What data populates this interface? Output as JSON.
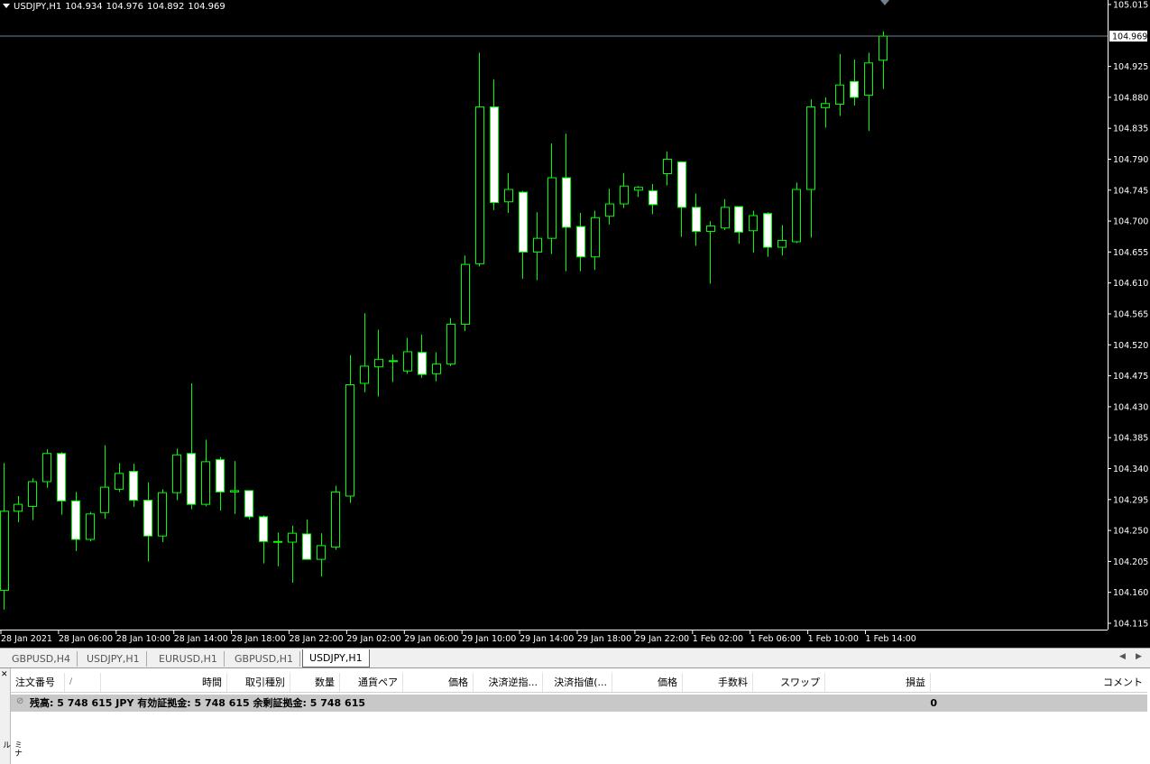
{
  "chart": {
    "symbol": "USDJPY,H1",
    "ohlc": {
      "open": "104.934",
      "high": "104.976",
      "low": "104.892",
      "close": "104.969"
    },
    "current_price": "104.969",
    "price_scale": [
      "105.015",
      "104.925",
      "104.880",
      "104.835",
      "104.790",
      "104.745",
      "104.700",
      "104.655",
      "104.610",
      "104.565",
      "104.520",
      "104.475",
      "104.430",
      "104.385",
      "104.340",
      "104.295",
      "104.250",
      "104.205",
      "104.160",
      "104.115"
    ],
    "time_labels": [
      "28 Jan 2021",
      "28 Jan 06:00",
      "28 Jan 10:00",
      "28 Jan 14:00",
      "28 Jan 18:00",
      "28 Jan 22:00",
      "29 Jan 02:00",
      "29 Jan 06:00",
      "29 Jan 10:00",
      "29 Jan 14:00",
      "29 Jan 18:00",
      "29 Jan 22:00",
      "1 Feb 02:00",
      "1 Feb 06:00",
      "1 Feb 10:00",
      "1 Feb 14:00"
    ],
    "colors": {
      "background": "#000000",
      "bull_wick": "#00ff00",
      "bear_body": "#ffffff",
      "price_line": "#708090",
      "axis": "#ffffff"
    },
    "candles": [
      {
        "o": 104.163,
        "h": 104.348,
        "l": 104.135,
        "c": 104.278
      },
      {
        "o": 104.278,
        "h": 104.3,
        "l": 104.262,
        "c": 104.288
      },
      {
        "o": 104.285,
        "h": 104.326,
        "l": 104.265,
        "c": 104.321
      },
      {
        "o": 104.321,
        "h": 104.368,
        "l": 104.312,
        "c": 104.362
      },
      {
        "o": 104.362,
        "h": 104.364,
        "l": 104.273,
        "c": 104.293
      },
      {
        "o": 104.293,
        "h": 104.306,
        "l": 104.22,
        "c": 104.237
      },
      {
        "o": 104.237,
        "h": 104.277,
        "l": 104.234,
        "c": 104.274
      },
      {
        "o": 104.276,
        "h": 104.374,
        "l": 104.267,
        "c": 104.313
      },
      {
        "o": 104.31,
        "h": 104.348,
        "l": 104.306,
        "c": 104.333
      },
      {
        "o": 104.336,
        "h": 104.347,
        "l": 104.284,
        "c": 104.294
      },
      {
        "o": 104.294,
        "h": 104.32,
        "l": 104.205,
        "c": 104.242
      },
      {
        "o": 104.242,
        "h": 104.31,
        "l": 104.233,
        "c": 104.305
      },
      {
        "o": 104.305,
        "h": 104.369,
        "l": 104.294,
        "c": 104.36
      },
      {
        "o": 104.362,
        "h": 104.464,
        "l": 104.281,
        "c": 104.288
      },
      {
        "o": 104.288,
        "h": 104.382,
        "l": 104.285,
        "c": 104.35
      },
      {
        "o": 104.353,
        "h": 104.357,
        "l": 104.279,
        "c": 104.306
      },
      {
        "o": 104.306,
        "h": 104.351,
        "l": 104.274,
        "c": 104.308
      },
      {
        "o": 104.308,
        "h": 104.306,
        "l": 104.266,
        "c": 104.27
      },
      {
        "o": 104.27,
        "h": 104.272,
        "l": 104.202,
        "c": 104.234
      },
      {
        "o": 104.234,
        "h": 104.247,
        "l": 104.198,
        "c": 104.234
      },
      {
        "o": 104.233,
        "h": 104.257,
        "l": 104.174,
        "c": 104.246
      },
      {
        "o": 104.245,
        "h": 104.266,
        "l": 104.216,
        "c": 104.208
      },
      {
        "o": 104.208,
        "h": 104.246,
        "l": 104.183,
        "c": 104.228
      },
      {
        "o": 104.226,
        "h": 104.315,
        "l": 104.222,
        "c": 104.306
      },
      {
        "o": 104.3,
        "h": 104.505,
        "l": 104.29,
        "c": 104.462
      },
      {
        "o": 104.464,
        "h": 104.566,
        "l": 104.451,
        "c": 104.489
      },
      {
        "o": 104.488,
        "h": 104.542,
        "l": 104.445,
        "c": 104.499
      },
      {
        "o": 104.496,
        "h": 104.506,
        "l": 104.466,
        "c": 104.497
      },
      {
        "o": 104.482,
        "h": 104.53,
        "l": 104.478,
        "c": 104.51
      },
      {
        "o": 104.509,
        "h": 104.535,
        "l": 104.472,
        "c": 104.477
      },
      {
        "o": 104.478,
        "h": 104.509,
        "l": 104.467,
        "c": 104.492
      },
      {
        "o": 104.492,
        "h": 104.559,
        "l": 104.489,
        "c": 104.55
      },
      {
        "o": 104.55,
        "h": 104.65,
        "l": 104.54,
        "c": 104.637
      },
      {
        "o": 104.638,
        "h": 104.945,
        "l": 104.634,
        "c": 104.866
      },
      {
        "o": 104.866,
        "h": 104.906,
        "l": 104.716,
        "c": 104.727
      },
      {
        "o": 104.728,
        "h": 104.77,
        "l": 104.712,
        "c": 104.746
      },
      {
        "o": 104.742,
        "h": 104.744,
        "l": 104.616,
        "c": 104.655
      },
      {
        "o": 104.655,
        "h": 104.713,
        "l": 104.614,
        "c": 104.675
      },
      {
        "o": 104.675,
        "h": 104.813,
        "l": 104.652,
        "c": 104.763
      },
      {
        "o": 104.763,
        "h": 104.827,
        "l": 104.627,
        "c": 104.691
      },
      {
        "o": 104.692,
        "h": 104.712,
        "l": 104.627,
        "c": 104.648
      },
      {
        "o": 104.648,
        "h": 104.715,
        "l": 104.629,
        "c": 104.705
      },
      {
        "o": 104.707,
        "h": 104.747,
        "l": 104.695,
        "c": 104.725
      },
      {
        "o": 104.725,
        "h": 104.77,
        "l": 104.719,
        "c": 104.751
      },
      {
        "o": 104.745,
        "h": 104.751,
        "l": 104.735,
        "c": 104.749
      },
      {
        "o": 104.744,
        "h": 104.754,
        "l": 104.71,
        "c": 104.724
      },
      {
        "o": 104.769,
        "h": 104.801,
        "l": 104.752,
        "c": 104.79
      },
      {
        "o": 104.786,
        "h": 104.787,
        "l": 104.677,
        "c": 104.72
      },
      {
        "o": 104.72,
        "h": 104.74,
        "l": 104.664,
        "c": 104.685
      },
      {
        "o": 104.685,
        "h": 104.7,
        "l": 104.609,
        "c": 104.693
      },
      {
        "o": 104.69,
        "h": 104.732,
        "l": 104.687,
        "c": 104.72
      },
      {
        "o": 104.721,
        "h": 104.721,
        "l": 104.667,
        "c": 104.684
      },
      {
        "o": 104.686,
        "h": 104.715,
        "l": 104.654,
        "c": 104.708
      },
      {
        "o": 104.711,
        "h": 104.713,
        "l": 104.648,
        "c": 104.662
      },
      {
        "o": 104.662,
        "h": 104.694,
        "l": 104.65,
        "c": 104.672
      },
      {
        "o": 104.67,
        "h": 104.756,
        "l": 104.668,
        "c": 104.746
      },
      {
        "o": 104.746,
        "h": 104.877,
        "l": 104.676,
        "c": 104.866
      },
      {
        "o": 104.865,
        "h": 104.88,
        "l": 104.836,
        "c": 104.871
      },
      {
        "o": 104.87,
        "h": 104.943,
        "l": 104.853,
        "c": 104.898
      },
      {
        "o": 104.903,
        "h": 104.935,
        "l": 104.868,
        "c": 104.88
      },
      {
        "o": 104.883,
        "h": 104.945,
        "l": 104.831,
        "c": 104.93
      },
      {
        "o": 104.934,
        "h": 104.976,
        "l": 104.892,
        "c": 104.969
      }
    ]
  },
  "tabs": [
    "GBPUSD,H4",
    "USDJPY,H1",
    "EURUSD,H1",
    "GBPUSD,H1",
    "USDJPY,H1"
  ],
  "terminal": {
    "columns": [
      "注文番号",
      "/",
      "時間",
      "取引種別",
      "数量",
      "通貨ペア",
      "価格",
      "決済逆指...",
      "決済指値(...",
      "価格",
      "手数料",
      "スワップ",
      "損益",
      "コメント"
    ],
    "balance_line": "残高: 5 748 615 JPY  有効証拠金: 5 748 615  余剰証拠金: 5 748 615",
    "profit": "0",
    "sidebar_label": "ミナル"
  }
}
